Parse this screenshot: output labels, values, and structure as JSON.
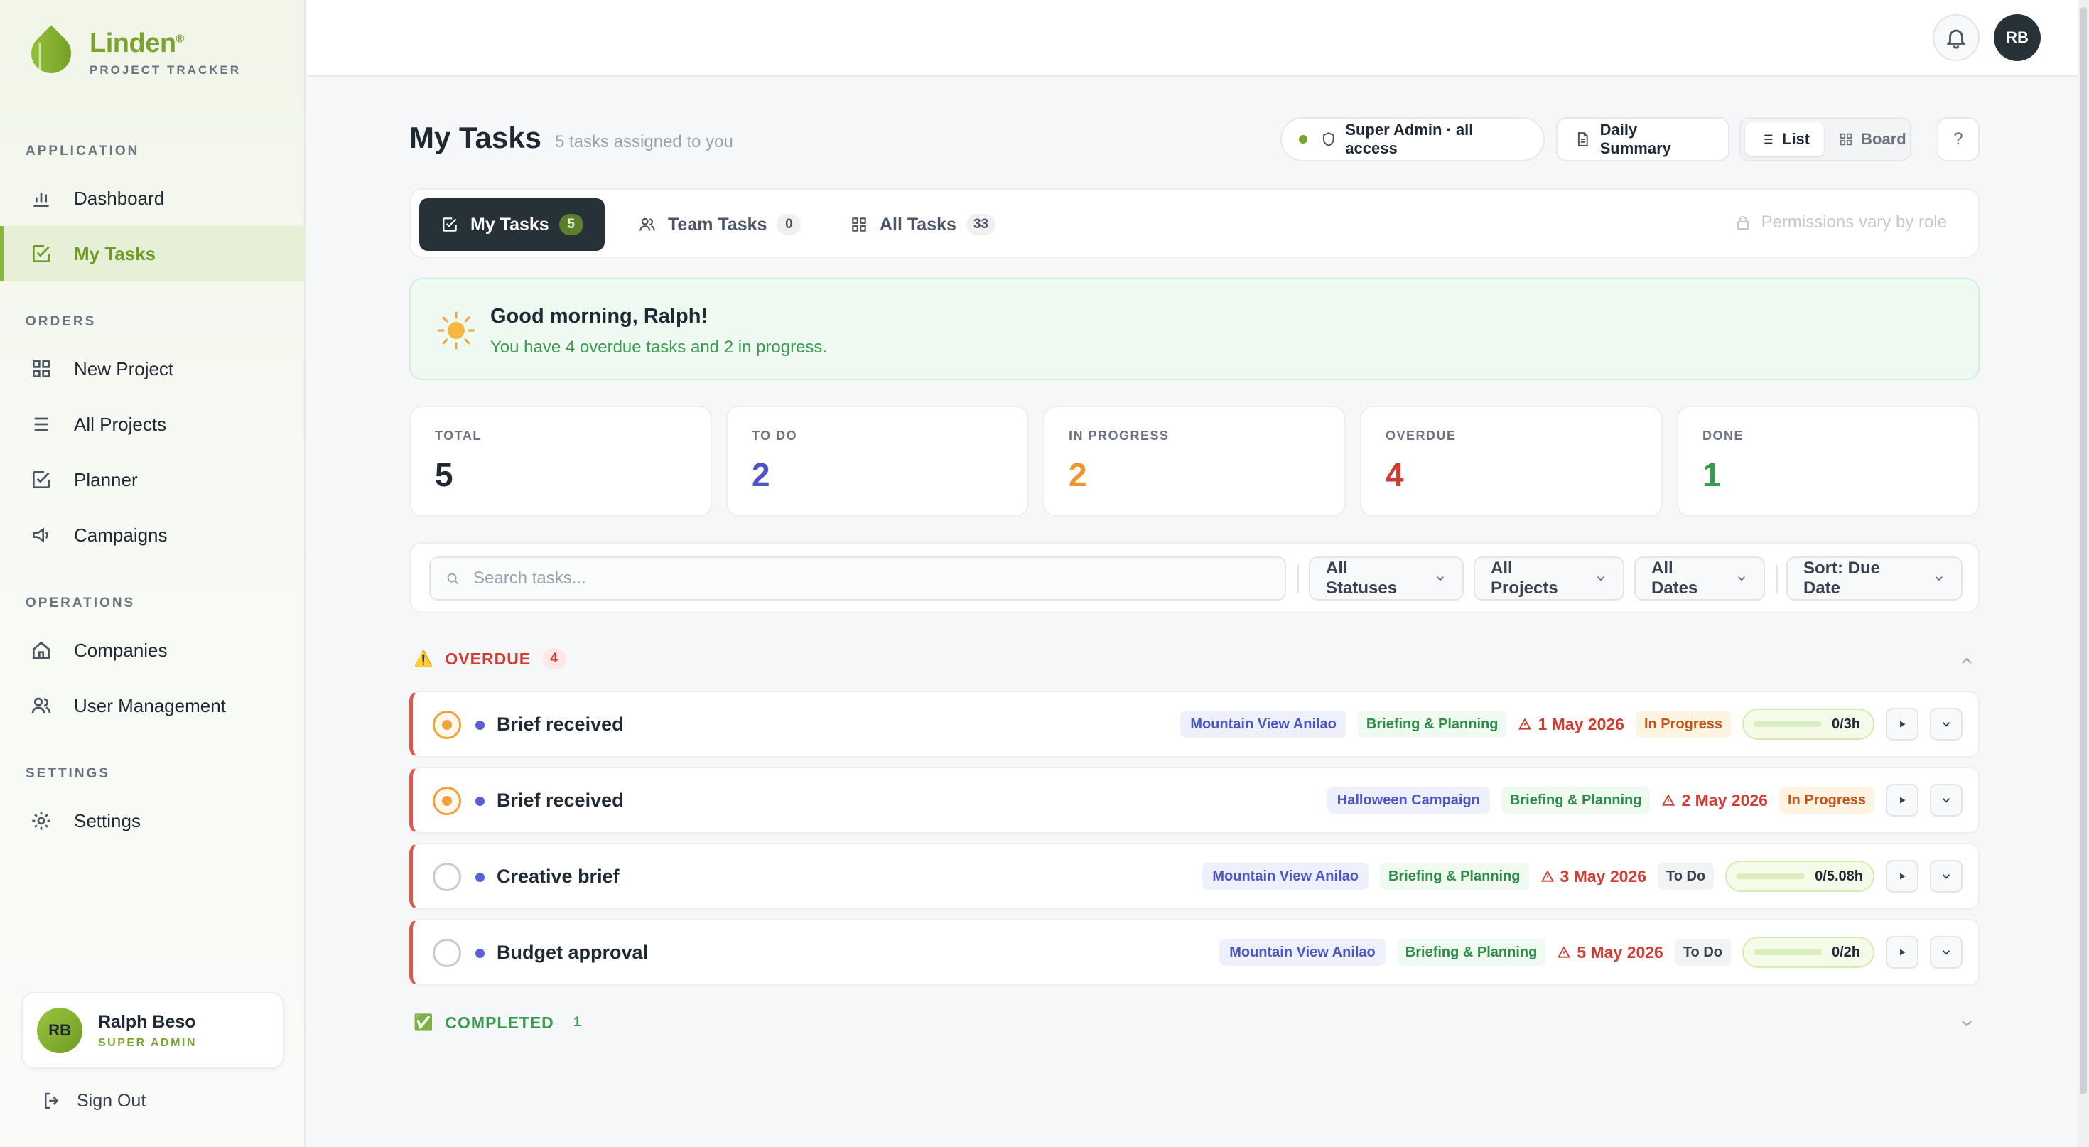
{
  "brand": {
    "name": "Linden",
    "mark": "®",
    "subtitle": "PROJECT TRACKER"
  },
  "sidebar": {
    "sections": [
      {
        "title": "APPLICATION"
      },
      {
        "title": "ORDERS"
      },
      {
        "title": "OPERATIONS"
      },
      {
        "title": "SETTINGS"
      }
    ],
    "items": [
      {
        "label": "Dashboard",
        "icon": "bar-chart-icon"
      },
      {
        "label": "My Tasks",
        "icon": "check-square-icon",
        "active": true
      },
      {
        "label": "New Project",
        "icon": "grid-icon"
      },
      {
        "label": "All Projects",
        "icon": "list-icon"
      },
      {
        "label": "Planner",
        "icon": "check-square-icon"
      },
      {
        "label": "Campaigns",
        "icon": "megaphone-icon"
      },
      {
        "label": "Companies",
        "icon": "home-icon"
      },
      {
        "label": "User Management",
        "icon": "users-icon"
      },
      {
        "label": "Settings",
        "icon": "gear-icon"
      }
    ],
    "user": {
      "initials": "RB",
      "name": "Ralph Beso",
      "role": "SUPER ADMIN"
    },
    "signout_label": "Sign Out"
  },
  "topbar": {
    "avatar_initials": "RB"
  },
  "page": {
    "title": "My Tasks",
    "subtitle": "5 tasks assigned to you",
    "access_label": "Super Admin · all access",
    "summary_label": "Daily Summary",
    "view_list": "List",
    "view_board": "Board",
    "help": "?"
  },
  "tabs": [
    {
      "label": "My Tasks",
      "count": "5",
      "selected": true
    },
    {
      "label": "Team Tasks",
      "count": "0"
    },
    {
      "label": "All Tasks",
      "count": "33"
    }
  ],
  "permissions_note": "Permissions vary by role",
  "greeting": {
    "title": "Good morning, Ralph!",
    "message": "You have 4 overdue tasks and 2 in progress."
  },
  "stats": [
    {
      "label": "TOTAL",
      "value": "5",
      "color": "#1f2933"
    },
    {
      "label": "TO DO",
      "value": "2",
      "color": "#4b55c4"
    },
    {
      "label": "IN PROGRESS",
      "value": "2",
      "color": "#e8962e"
    },
    {
      "label": "OVERDUE",
      "value": "4",
      "color": "#d23a32"
    },
    {
      "label": "DONE",
      "value": "1",
      "color": "#3a9b4e"
    }
  ],
  "filters": {
    "search_placeholder": "Search tasks...",
    "status": "All Statuses",
    "projects": "All Projects",
    "dates": "All Dates",
    "sort": "Sort: Due Date"
  },
  "groups": {
    "overdue": {
      "label": "OVERDUE",
      "count": "4",
      "emoji": "⚠️"
    },
    "completed": {
      "label": "COMPLETED",
      "count": "1",
      "emoji": "✅"
    }
  },
  "tasks": [
    {
      "title": "Brief received",
      "project": "Mountain View Anilao",
      "phase": "Briefing & Planning",
      "date": "1 May 2026",
      "status": "In Progress",
      "hours": "0/3h",
      "progress": 0
    },
    {
      "title": "Brief received",
      "project": "Halloween Campaign",
      "phase": "Briefing & Planning",
      "date": "2 May 2026",
      "status": "In Progress",
      "hours": "",
      "progress": 0
    },
    {
      "title": "Creative brief",
      "project": "Mountain View Anilao",
      "phase": "Briefing & Planning",
      "date": "3 May 2026",
      "status": "To Do",
      "hours": "0/5.08h",
      "progress": 0
    },
    {
      "title": "Budget approval",
      "project": "Mountain View Anilao",
      "phase": "Briefing & Planning",
      "date": "5 May 2026",
      "status": "To Do",
      "hours": "0/2h",
      "progress": 0
    }
  ],
  "colors": {
    "accent": "#7aa42e",
    "dark": "#273238",
    "overdue": "#d23a32",
    "progress": "#f0a33c"
  }
}
